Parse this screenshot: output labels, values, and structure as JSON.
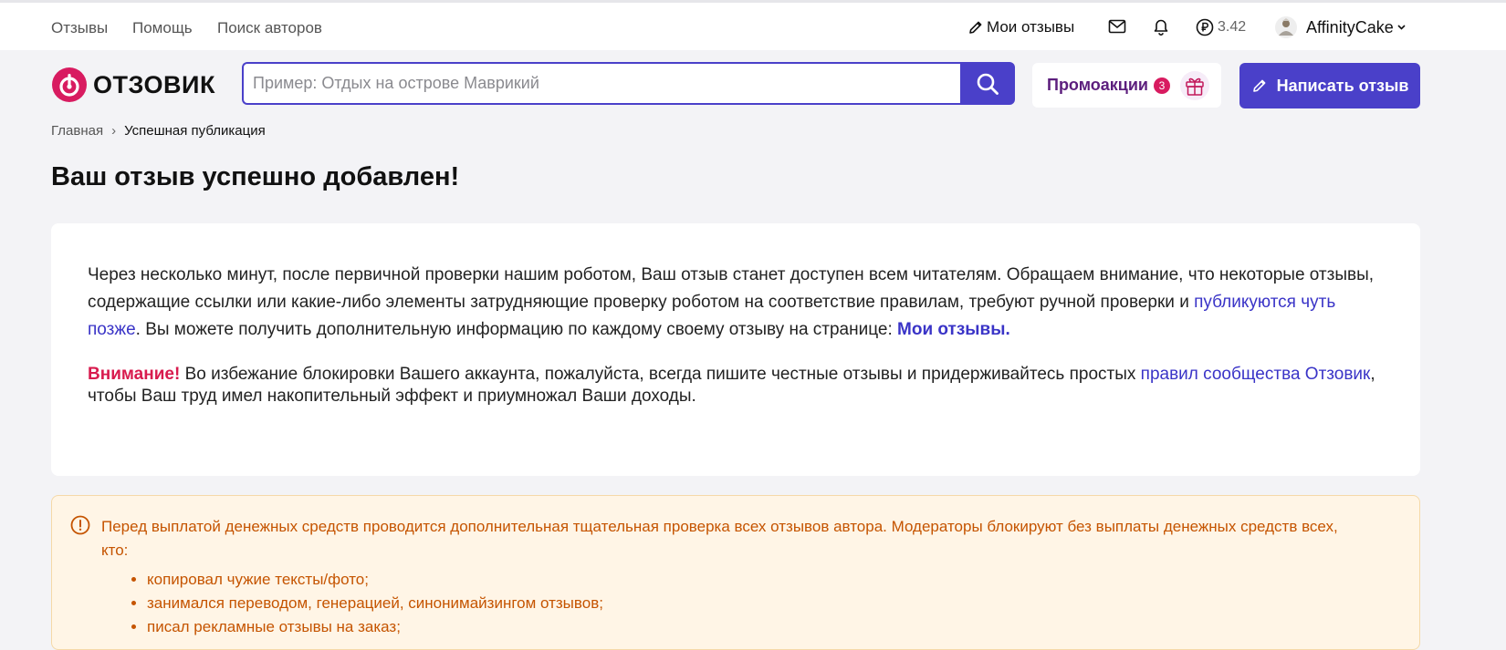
{
  "top_nav": {
    "links": [
      "Отзывы",
      "Помощь",
      "Поиск авторов"
    ],
    "my_reviews": "Мои отзывы",
    "balance": "3.42",
    "username": "AffinityCake"
  },
  "header": {
    "logo_text": "ОТЗОВИК",
    "search_placeholder": "Пример: Отдых на острове Маврикий",
    "promo_label": "Промоакции",
    "promo_count": "3",
    "write_button": "Написать отзыв"
  },
  "breadcrumb": {
    "home": "Главная",
    "separator": "›",
    "current": "Успешная публикация"
  },
  "page_title": "Ваш отзыв успешно добавлен!",
  "info_card": {
    "p1_text": "Через несколько минут, после первичной проверки нашим роботом, Ваш отзыв станет доступен всем читателям. Обращаем внимание, что некоторые отзывы, содержащие ссылки или какие-либо элементы затрудняющие проверку роботом на соответствие правилам, требуют ручной проверки и ",
    "p1_link": "публикуются чуть позже",
    "p1_text2": ". Вы можете получить дополнительную информацию по каждому своему отзыву на странице: ",
    "p1_link2": "Мои отзывы.",
    "p2_warn": "Внимание!",
    "p2_text": " Во избежание блокировки Вашего аккаунта, пожалуйста, всегда пишите честные отзывы и придерживайтесь простых ",
    "p2_link": "правил сообщества Отзовик",
    "p2_text2": ", чтобы Ваш труд имел накопительный эффект и приумножал Ваши доходы."
  },
  "notice": {
    "text": "Перед выплатой денежных средств проводится дополнительная тщательная проверка всех отзывов автора. Модераторы блокируют без выплаты денежных средств всех, кто:",
    "items": [
      "копировал чужие тексты/фото;",
      "занимался переводом, генерацией, синонимайзингом отзывов;",
      "писал рекламные отзывы на заказ;"
    ]
  },
  "colors": {
    "accent": "#4a40c9",
    "warning_red": "#d81b4e",
    "notice_text": "#c55400",
    "notice_bg": "#fff5e6",
    "promo_text": "#5c1e7d"
  },
  "icons": [
    "pencil-icon",
    "mail-icon",
    "bell-icon",
    "ruble-coin-icon",
    "avatar",
    "chevron-down-icon",
    "search-icon",
    "gift-icon",
    "alert-circle-icon"
  ]
}
